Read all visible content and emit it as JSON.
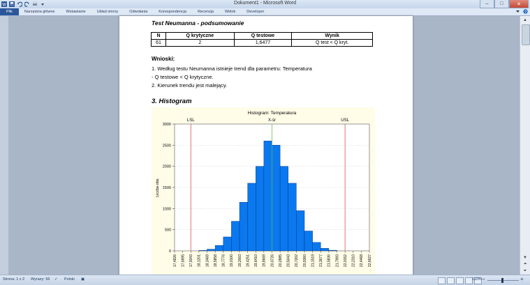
{
  "window": {
    "title": "Dokument1 - Microsoft Word"
  },
  "ribbon": {
    "tabs": [
      "Plik",
      "Narzędzia główne",
      "Wstawianie",
      "Układ strony",
      "Odwołania",
      "Korespondencja",
      "Recenzja",
      "Widok",
      "Developer"
    ]
  },
  "document": {
    "test_title": "Test Neumanna - podsumowanie",
    "table": {
      "headers": [
        "N",
        "Q krytyczne",
        "Q testowe",
        "Wynik"
      ],
      "row": [
        "61",
        "2",
        "1,6477",
        "Q test < Q kryt."
      ]
    },
    "conclusions_title": "Wnioski:",
    "conclusions": [
      "1. Według testu Neumanna istnieje trend dla parametru: Temperatura",
      "- Q testowe < Q krytyczne.",
      "2. Kierunek trendu jest malejący."
    ],
    "histogram_heading": "3. Histogram"
  },
  "chart_data": {
    "type": "bar",
    "title": "Histogram: Temperatura",
    "ylabel": "Liczba obs.",
    "xlabel": "",
    "ylim": [
      0,
      3000
    ],
    "yticks": [
      0,
      500,
      1000,
      1500,
      2000,
      2500,
      3000
    ],
    "xticks": [
      "17,4826",
      "17,6695",
      "17,9343",
      "18,1201",
      "18,3469",
      "18,5858",
      "18,7776",
      "19,0100",
      "19,2003",
      "19,4251",
      "19,6410",
      "19,8669",
      "20,0726",
      "20,2885",
      "20,5043",
      "20,7202",
      "20,9360",
      "21,1519",
      "21,3677",
      "21,5836",
      "21,7993",
      "22,0152",
      "22,2310",
      "22,4468",
      "22,6627"
    ],
    "values": [
      0,
      0,
      0,
      10,
      40,
      130,
      330,
      700,
      1150,
      1600,
      2000,
      2600,
      2500,
      2000,
      1600,
      950,
      470,
      200,
      60,
      15,
      0,
      0,
      0,
      0
    ],
    "bar_color": "#0a78ef",
    "limits": [
      {
        "label": "LSL",
        "x": "17,9343",
        "color": "#d9534f"
      },
      {
        "label": "X-śr",
        "x": "20,0726",
        "color": "#6fbf4a"
      },
      {
        "label": "USL",
        "x": "22,0152",
        "color": "#d9534f"
      }
    ],
    "grid": true
  },
  "status_bar": {
    "page": "Strona: 1 z 2",
    "words": "Wyrazy: 56",
    "language": "Polski",
    "zoom": "110%"
  },
  "colors": {
    "accent": "#2b579a"
  }
}
